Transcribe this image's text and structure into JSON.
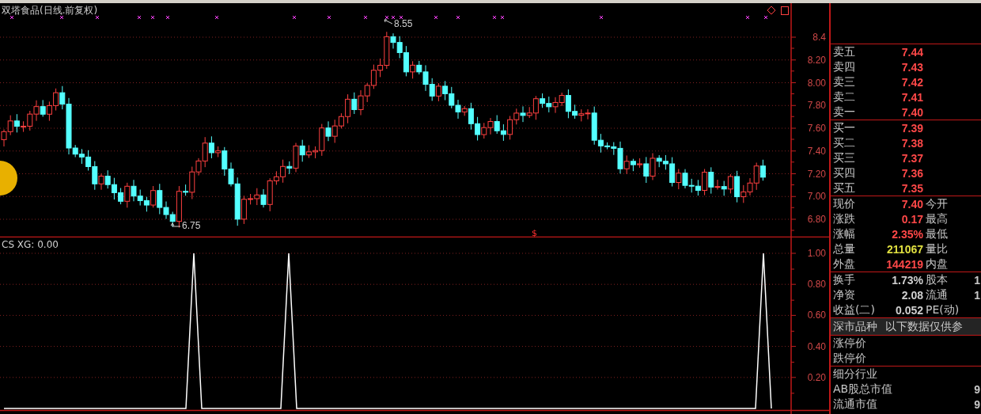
{
  "chart_title": "双塔食品(日线.前复权)",
  "price_pane": {
    "ticks": [
      "8.4",
      "8.20",
      "8.00",
      "7.80",
      "7.60",
      "7.40",
      "7.20",
      "7.00",
      "6.80"
    ],
    "high_label": "8.55",
    "low_label": "6.75",
    "signal_mark": "$"
  },
  "indicator_pane": {
    "chart_data": {
      "type": "line",
      "title": "CS XG: 0.00",
      "grid": true,
      "ylim": [
        0,
        1
      ],
      "yticks": [
        {
          "value": 1,
          "label": "1.00"
        },
        {
          "value": 0.8,
          "label": "0.80"
        },
        {
          "value": 0.6,
          "label": "0.60"
        },
        {
          "value": 0.4,
          "label": "0.40"
        },
        {
          "value": 0.2,
          "label": "0.20"
        }
      ],
      "series": [
        {
          "color": "#ffffff",
          "values": [
            0,
            0,
            0,
            0,
            0,
            0,
            0,
            0,
            0,
            0,
            0,
            0,
            0,
            0,
            0,
            0,
            0,
            0,
            0,
            0,
            0,
            0,
            0,
            0,
            1,
            0,
            0,
            0,
            0,
            0,
            0,
            0,
            0,
            0,
            0,
            0,
            1,
            0,
            0,
            0,
            0,
            0,
            0,
            0,
            0,
            0,
            0,
            0,
            0,
            0,
            0,
            0,
            0,
            0,
            0,
            0,
            0,
            0,
            0,
            0,
            0,
            0,
            0,
            0,
            0,
            0,
            0,
            0,
            0,
            0,
            0,
            0,
            0,
            0,
            0,
            0,
            0,
            0,
            0,
            0,
            0,
            0,
            0,
            0,
            0,
            0,
            0,
            0,
            0,
            0,
            0,
            0,
            0,
            0,
            0,
            0,
            1,
            0
          ]
        }
      ]
    }
  },
  "quote_panel": {
    "sections": [
      {
        "kind": "rows",
        "rows": [
          {
            "label": "卖五",
            "value": "7.44",
            "color": "#ff4848"
          },
          {
            "label": "卖四",
            "value": "7.43",
            "color": "#ff4848"
          },
          {
            "label": "卖三",
            "value": "7.42",
            "color": "#ff4848"
          },
          {
            "label": "卖二",
            "value": "7.41",
            "color": "#ff4848"
          },
          {
            "label": "卖一",
            "value": "7.40",
            "color": "#ff4848"
          }
        ]
      },
      {
        "kind": "rows",
        "rows": [
          {
            "label": "买一",
            "value": "7.39",
            "color": "#ff4848"
          },
          {
            "label": "买二",
            "value": "7.38",
            "color": "#ff4848"
          },
          {
            "label": "买三",
            "value": "7.37",
            "color": "#ff4848"
          },
          {
            "label": "买四",
            "value": "7.36",
            "color": "#ff4848"
          },
          {
            "label": "买五",
            "value": "7.35",
            "color": "#ff4848"
          }
        ]
      },
      {
        "kind": "rows",
        "rows": [
          {
            "label": "现价",
            "value": "7.40",
            "color": "#ff4848",
            "label_2": "今开"
          },
          {
            "label": "涨跌",
            "value": "0.17",
            "color": "#ff4848",
            "label_2": "最高"
          },
          {
            "label": "涨幅",
            "value": "2.35%",
            "color": "#ff4848",
            "label_2": "最低"
          },
          {
            "label": "总量",
            "value": "211067",
            "color": "#e0e040",
            "label_2": "量比"
          },
          {
            "label": "外盘",
            "value": "144219",
            "color": "#ff4848",
            "label_2": "内盘"
          }
        ]
      },
      {
        "kind": "rows",
        "rows": [
          {
            "label": "换手",
            "value": "1.73%",
            "color": "#d0d0d0",
            "label_2": "股本",
            "value_2": "1"
          },
          {
            "label": "净资",
            "value": "2.08",
            "color": "#d0d0d0",
            "label_2": "流通",
            "value_2": "1"
          },
          {
            "label": "收益(二)",
            "value": "0.052",
            "color": "#d0d0d0",
            "label_2": "PE(动)"
          }
        ]
      },
      {
        "kind": "header",
        "rows": [
          {
            "label": "深市品种",
            "note": "以下数据仅供参"
          }
        ]
      },
      {
        "kind": "rows",
        "rows": [
          {
            "label": "涨停价"
          },
          {
            "label": "跌停价"
          }
        ]
      },
      {
        "kind": "rows",
        "rows": [
          {
            "label": "细分行业"
          },
          {
            "label": "AB股总市值",
            "value_2": "9"
          },
          {
            "label": "流通市值",
            "value_2": "9"
          }
        ]
      }
    ]
  }
}
